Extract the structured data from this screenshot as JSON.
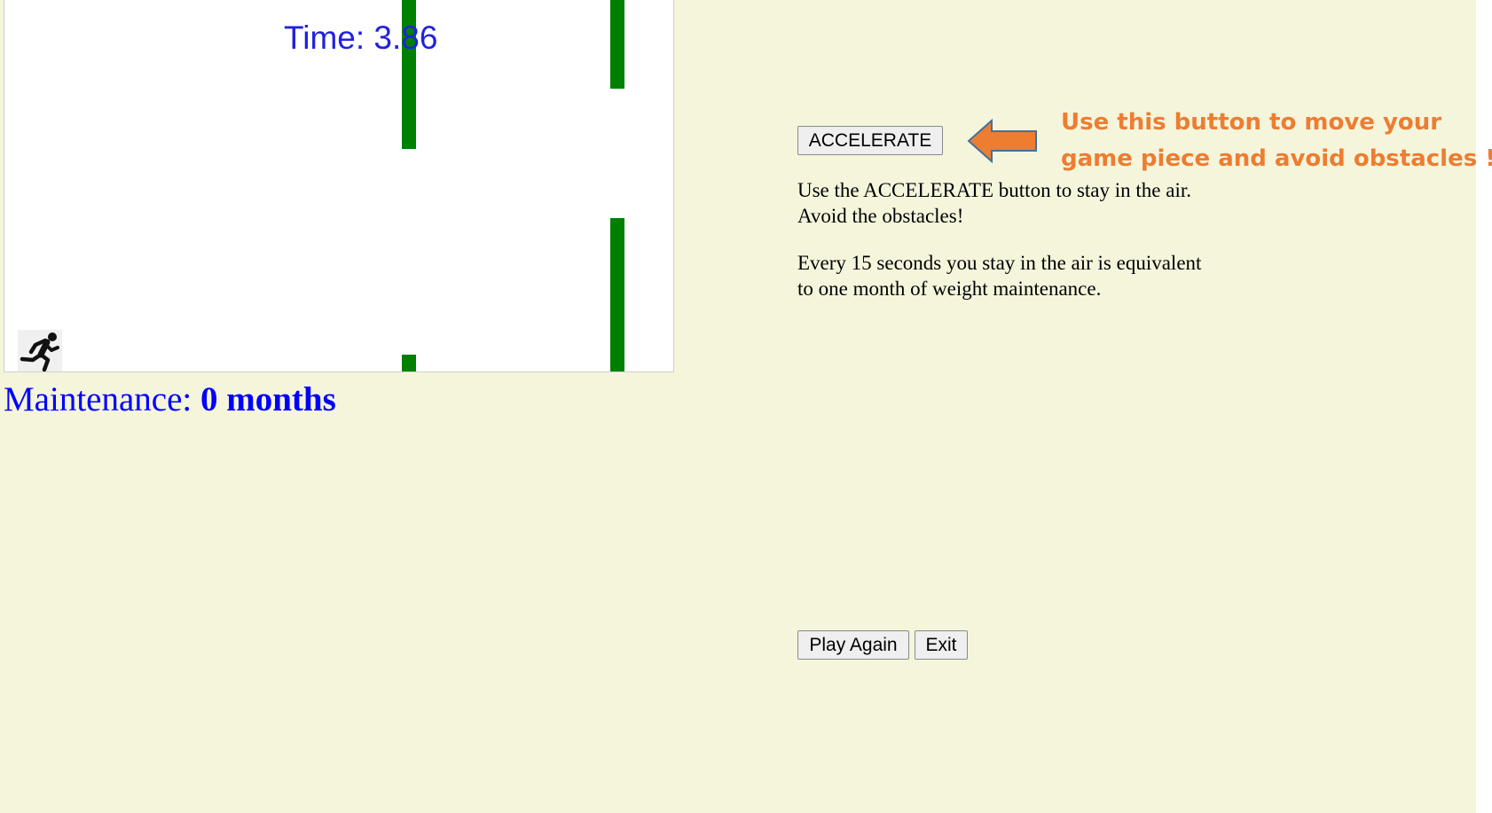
{
  "game": {
    "time_label": "Time: 3.86",
    "pipe_color": "#008000",
    "player_icon": "running-person-icon"
  },
  "status": {
    "maintenance_prefix": "Maintenance: ",
    "maintenance_value": "0 months"
  },
  "controls": {
    "accelerate_label": "ACCELERATE",
    "play_again_label": "Play Again",
    "exit_label": "Exit"
  },
  "instructions": {
    "line1": "Use the ACCELERATE button to stay in the air. Avoid the obstacles!",
    "line2": "Every 15 seconds you stay in the air is equivalent to one month of weight maintenance."
  },
  "annotation": {
    "hint_line1": "Use this button to move your",
    "hint_line2": "game piece and avoid obstacles !",
    "arrow_icon": "left-arrow-icon",
    "accent_color": "#ed7d31"
  },
  "colors": {
    "page_background": "#f5f5dc",
    "status_text": "#0000ff",
    "time_text": "#2222dd"
  }
}
